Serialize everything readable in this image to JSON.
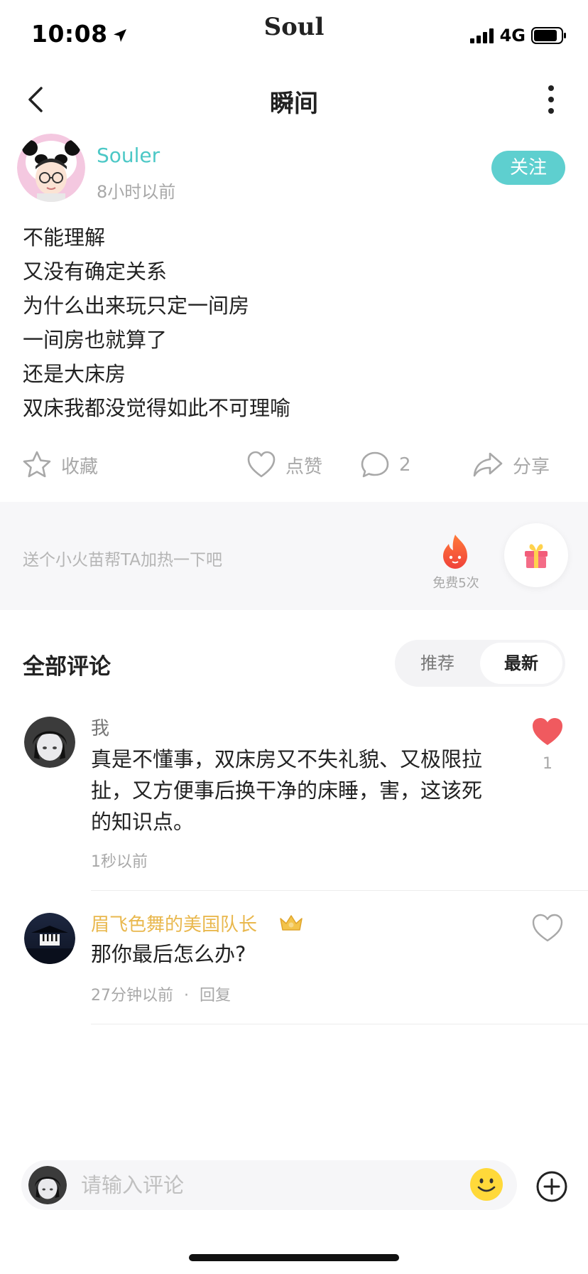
{
  "status_bar": {
    "time": "10:08",
    "app_name": "Soul",
    "network": "4G"
  },
  "nav": {
    "title": "瞬间"
  },
  "post": {
    "author": "Souler",
    "time": "8小时以前",
    "follow_label": "关注",
    "lines": [
      "不能理解",
      "又没有确定关系",
      "为什么出来玩只定一间房",
      "一间房也就算了",
      "还是大床房",
      "双床我都没觉得如此不可理喻"
    ]
  },
  "actions": {
    "collect_label": "收藏",
    "like_label": "点赞",
    "comment_count": "2",
    "share_label": "分享"
  },
  "heat": {
    "prompt": "送个小火苗帮TA加热一下吧",
    "free_label": "免费5次"
  },
  "comments_section": {
    "title": "全部评论",
    "sort_options": [
      "推荐",
      "最新"
    ],
    "selected_sort": "最新"
  },
  "comments": [
    {
      "author": "我",
      "text_lines": [
        "真是不懂事，双床房又不失礼貌、又极限拉",
        "扯，又方便事后换干净的床睡，害，这该死",
        "的知识点。"
      ],
      "time": "1秒以前",
      "likes": "1",
      "liked": true
    },
    {
      "author": "眉飞色舞的美国队长",
      "text_lines": [
        "那你最后怎么办?"
      ],
      "time": "27分钟以前",
      "separator": "·",
      "reply_label": "回复",
      "liked": false
    }
  ],
  "input": {
    "placeholder": "请输入评论"
  },
  "colors": {
    "accent": "#5ecfcf",
    "author": "#4cc8c6",
    "like_active": "#f05a5f",
    "gold_name": "#e9b84e",
    "muted": "#a8a8a8"
  }
}
